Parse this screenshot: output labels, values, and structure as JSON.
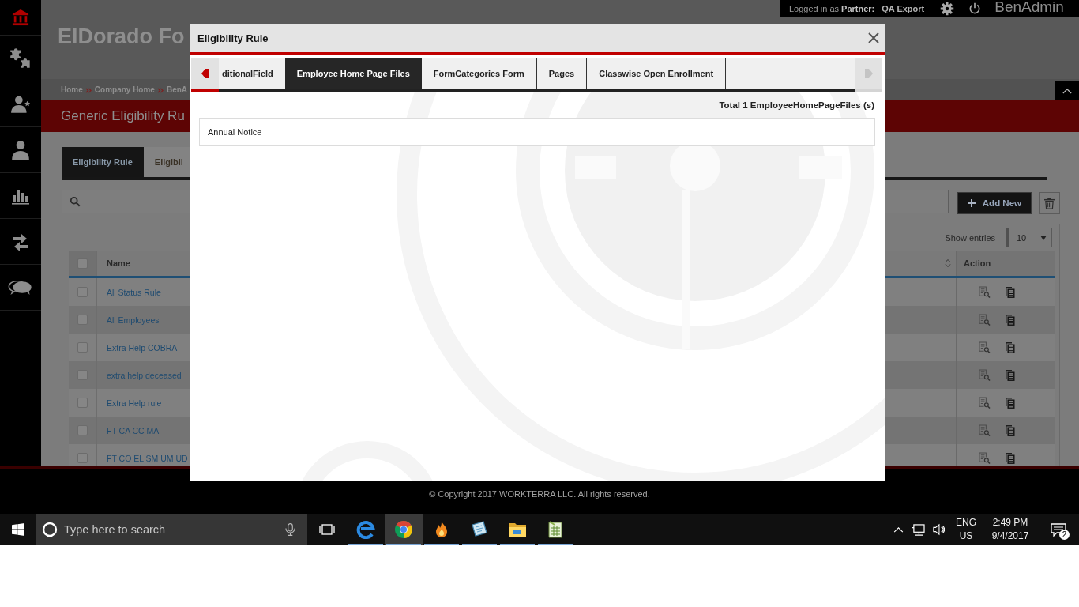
{
  "sidebar": {
    "items": [
      {
        "kind": "home",
        "selected": true
      },
      {
        "kind": "puzzle",
        "selected": false
      },
      {
        "kind": "person-star",
        "selected": false
      },
      {
        "kind": "person",
        "selected": false
      },
      {
        "kind": "chart",
        "selected": false
      },
      {
        "kind": "transfer",
        "selected": false
      },
      {
        "kind": "chat",
        "selected": false
      }
    ]
  },
  "header": {
    "title": "ElDorado Fo",
    "login_label": "Logged in as **Partner:**",
    "partner": "QA Export",
    "user": "BenAdmin"
  },
  "breadcrumb": [
    "Home",
    "Company Home",
    "BenA"
  ],
  "page_title": "Generic Eligibility Ru",
  "page_tabs": [
    {
      "label": "Eligibility Rule",
      "selected": true
    },
    {
      "label": "Eligibil",
      "selected": false
    }
  ],
  "add_button": "Add New",
  "table": {
    "show_entries_label": "Show entries",
    "page_size": "10",
    "select_all_checked": false,
    "columns": [
      "Name",
      "Action"
    ],
    "rows": [
      {
        "name": "All Status Rule",
        "checked": false
      },
      {
        "name": "All Employees",
        "checked": false
      },
      {
        "name": "Extra Help COBRA",
        "checked": false
      },
      {
        "name": "extra help deceased",
        "checked": false
      },
      {
        "name": "Extra Help rule",
        "checked": false
      },
      {
        "name": "FT CA CC MA",
        "checked": false
      },
      {
        "name": "FT CO EL SM UM UD",
        "checked": false
      }
    ]
  },
  "footer": {
    "copyright": "© Copyright 2017 WORKTERRA LLC. All rights reserved."
  },
  "modal": {
    "title": "Eligibility Rule",
    "scroll_left": {
      "disabled": false
    },
    "scroll_right": {
      "disabled": true
    },
    "tabs": [
      {
        "label": "ditionalField",
        "selected": false
      },
      {
        "label": "Employee Home Page Files",
        "selected": true
      },
      {
        "label": "FormCategories Form",
        "selected": false
      },
      {
        "label": "Pages",
        "selected": false
      },
      {
        "label": "Classwise Open Enrollment",
        "selected": false
      }
    ],
    "total": "Total 1 EmployeeHomePageFiles (s)",
    "items": [
      "Annual Notice"
    ]
  },
  "taskbar": {
    "search_placeholder": "Type here to search",
    "apps": [
      {
        "kind": "edge",
        "running": true,
        "selected": false
      },
      {
        "kind": "chrome",
        "running": true,
        "selected": true
      },
      {
        "kind": "flame",
        "running": true,
        "selected": false
      },
      {
        "kind": "notepad",
        "running": true,
        "selected": false
      },
      {
        "kind": "folder",
        "running": true,
        "selected": false
      },
      {
        "kind": "spreadsheet",
        "running": true,
        "selected": false
      }
    ],
    "language": "ENG",
    "region": "US",
    "time": "2:49 PM",
    "date": "9/4/2017",
    "notification_count": "2"
  }
}
